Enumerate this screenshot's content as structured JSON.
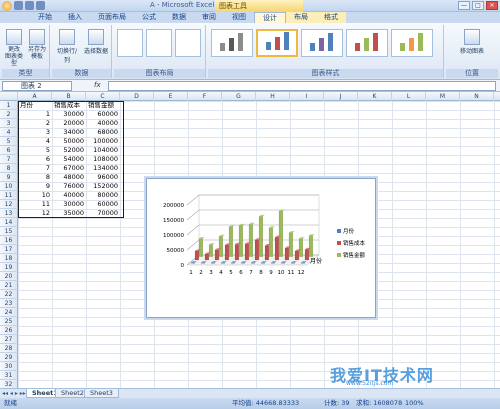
{
  "window": {
    "title": "A - Microsoft Excel",
    "context_title": "图表工具",
    "buttons": [
      "—",
      "□",
      "✕"
    ]
  },
  "tabs": [
    {
      "label": "开始",
      "active": false,
      "ctx": false
    },
    {
      "label": "插入",
      "active": false,
      "ctx": false
    },
    {
      "label": "页面布局",
      "active": false,
      "ctx": false
    },
    {
      "label": "公式",
      "active": false,
      "ctx": false
    },
    {
      "label": "数据",
      "active": false,
      "ctx": false
    },
    {
      "label": "审阅",
      "active": false,
      "ctx": false
    },
    {
      "label": "视图",
      "active": false,
      "ctx": false
    },
    {
      "label": "设计",
      "active": true,
      "ctx": true
    },
    {
      "label": "布局",
      "active": false,
      "ctx": true
    },
    {
      "label": "格式",
      "active": false,
      "ctx": true
    }
  ],
  "ribbon": {
    "groups": {
      "type": "类型",
      "data": "数据",
      "layout": "图表布局",
      "styles": "图表样式",
      "location": "位置"
    },
    "buttons": {
      "change_type": "更改\n图表类型",
      "save_template": "另存为\n模板",
      "switch_rowcol": "切换行/列",
      "select_data": "选择数据",
      "move_chart": "移动图表"
    }
  },
  "formula_bar": {
    "name_box": "图表 2",
    "fx": "fx",
    "formula": ""
  },
  "columns": [
    "A",
    "B",
    "C",
    "D",
    "E",
    "F",
    "G",
    "H",
    "I",
    "J",
    "K",
    "L",
    "M",
    "N"
  ],
  "rows": [
    "1",
    "2",
    "3",
    "4",
    "5",
    "6",
    "7",
    "8",
    "9",
    "10",
    "11",
    "12",
    "13",
    "14",
    "15",
    "16",
    "17",
    "18",
    "19",
    "20",
    "21",
    "22",
    "23",
    "24",
    "25",
    "26",
    "27",
    "28",
    "29",
    "30",
    "31",
    "32"
  ],
  "table": {
    "headers": [
      "月份",
      "销售成本",
      "销售金额"
    ],
    "data": [
      [
        "1",
        "30000",
        "60000"
      ],
      [
        "2",
        "20000",
        "40000"
      ],
      [
        "3",
        "34000",
        "68000"
      ],
      [
        "4",
        "50000",
        "100000"
      ],
      [
        "5",
        "52000",
        "104000"
      ],
      [
        "6",
        "54000",
        "108000"
      ],
      [
        "7",
        "67000",
        "134000"
      ],
      [
        "8",
        "48000",
        "96000"
      ],
      [
        "9",
        "76000",
        "152000"
      ],
      [
        "10",
        "40000",
        "80000"
      ],
      [
        "11",
        "30000",
        "60000"
      ],
      [
        "12",
        "35000",
        "70000"
      ]
    ]
  },
  "chart_data": {
    "type": "bar",
    "categories": [
      "1",
      "2",
      "3",
      "4",
      "5",
      "6",
      "7",
      "8",
      "9",
      "10",
      "11",
      "12"
    ],
    "series": [
      {
        "name": "月份",
        "values": [
          1,
          2,
          3,
          4,
          5,
          6,
          7,
          8,
          9,
          10,
          11,
          12
        ],
        "color": "#4f81bd"
      },
      {
        "name": "销售成本",
        "values": [
          30000,
          20000,
          34000,
          50000,
          52000,
          54000,
          67000,
          48000,
          76000,
          40000,
          30000,
          35000
        ],
        "color": "#c0504d"
      },
      {
        "name": "销售金额",
        "values": [
          60000,
          40000,
          68000,
          100000,
          104000,
          108000,
          134000,
          96000,
          152000,
          80000,
          60000,
          70000
        ],
        "color": "#9bbb59"
      }
    ],
    "yticks": [
      "0",
      "50000",
      "100000",
      "150000",
      "200000"
    ],
    "ylim": [
      0,
      200000
    ],
    "xlabel": "月份",
    "legend": "right",
    "grid": true
  },
  "sheets": [
    {
      "label": "Sheet1",
      "active": true
    },
    {
      "label": "Sheet2",
      "active": false
    },
    {
      "label": "Sheet3",
      "active": false
    }
  ],
  "status": {
    "ready": "就绪",
    "average": "平均值: 44668.83333",
    "count": "计数: 39",
    "sum": "求和: 1608078",
    "zoom": "100%"
  },
  "watermark": {
    "text": "我爱IT技术网",
    "url": "www.52itjs.com"
  },
  "colors": {
    "accent": "#15428b",
    "ribbon_bg": "#dbe6f4",
    "context_tab": "#f5d46b"
  }
}
